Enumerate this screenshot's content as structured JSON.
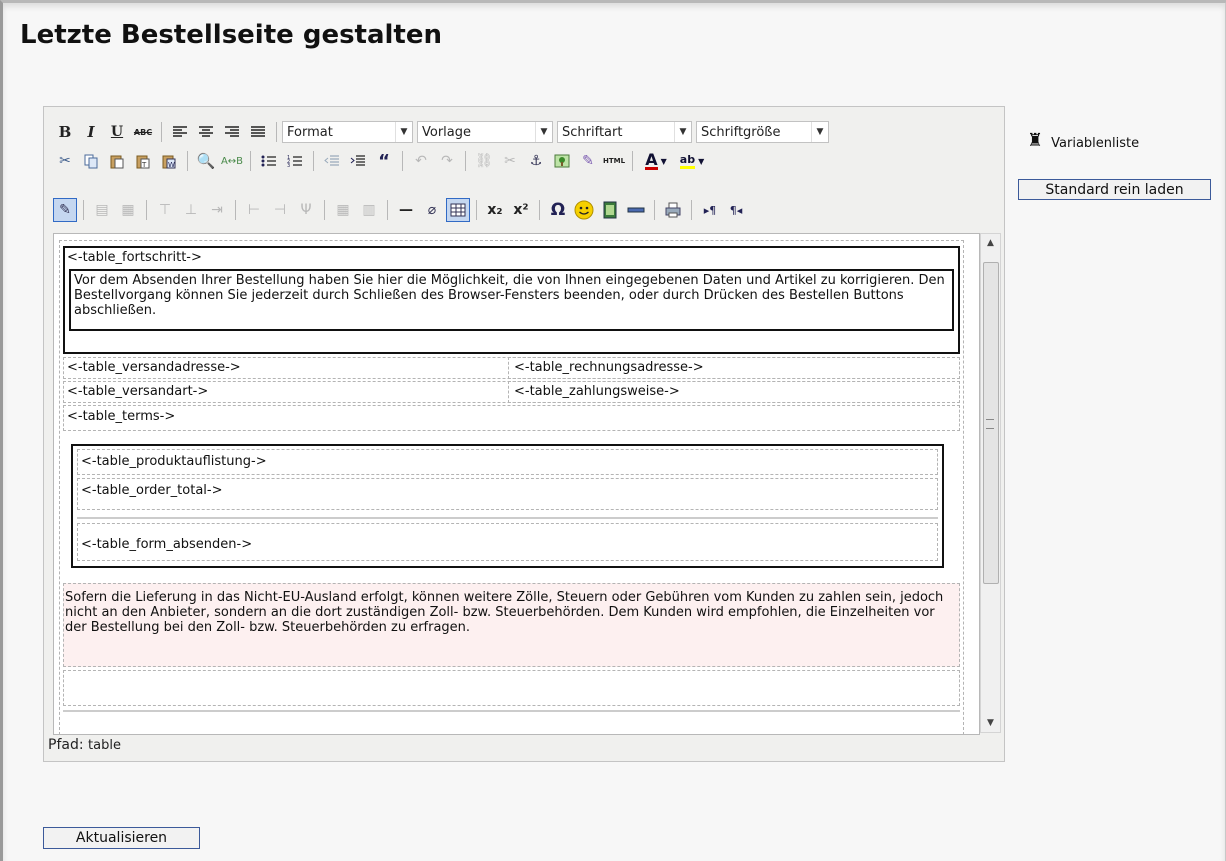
{
  "page": {
    "title": "Letzte Bestellseite gestalten"
  },
  "toolbar": {
    "format_label": "Format",
    "vorlage_label": "Vorlage",
    "schriftart_label": "Schriftart",
    "schriftgroesse_label": "Schriftgröße",
    "bold": "B",
    "italic": "I",
    "underline": "U",
    "strike": "ABC",
    "html": "HTML",
    "omega": "Ω",
    "sub": "x₂",
    "sup": "x²"
  },
  "content": {
    "fortschritt": "<-table_fortschritt->",
    "intro": "Vor dem Absenden Ihrer Bestellung haben Sie hier die Möglichkeit, die von Ihnen eingegebenen Daten und Artikel zu korrigieren. Den Bestellvorgang können Sie jederzeit durch Schließen des Browser-Fensters beenden, oder durch Drücken des Bestellen Buttons abschließen.",
    "versandadresse": "<-table_versandadresse->",
    "rechnungsadresse": "<-table_rechnungsadresse->",
    "versandart": "<-table_versandart->",
    "zahlungsweise": "<-table_zahlungsweise->",
    "terms": "<-table_terms->",
    "produktauflistung": "<-table_produktauflistung->",
    "order_total": "<-table_order_total->",
    "form_absenden": "<-table_form_absenden->",
    "notice": "Sofern die Lieferung in das Nicht-EU-Ausland erfolgt, können weitere Zölle, Steuern oder Gebühren vom Kunden zu zahlen sein, jedoch nicht an den Anbieter, sondern an die dort zuständigen Zoll- bzw. Steuerbehörden. Dem Kunden wird empfohlen, die Einzelheiten vor der Bestellung bei den Zoll- bzw. Steuerbehörden zu erfragen."
  },
  "path": {
    "label": "Pfad:",
    "value": "table"
  },
  "sidebar": {
    "variablenliste": "Variablenliste",
    "standard_button": "Standard rein laden"
  },
  "footer": {
    "update_button": "Aktualisieren"
  }
}
